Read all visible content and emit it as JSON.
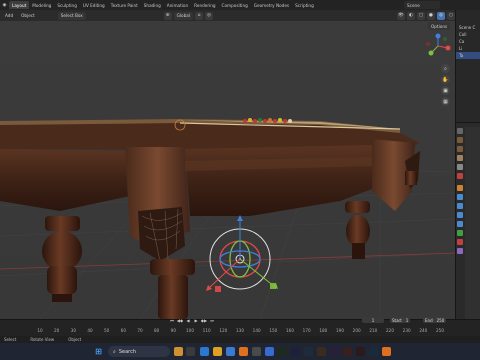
{
  "workspace_tabs": [
    "Layout",
    "Modeling",
    "Sculpting",
    "UV Editing",
    "Texture Paint",
    "Shading",
    "Animation",
    "Rendering",
    "Compositing",
    "Geometry Nodes",
    "Scripting"
  ],
  "active_tab": "Layout",
  "scene": {
    "label": "Scene"
  },
  "viewport_header": {
    "mode": "Add",
    "object_menu": "Object",
    "orientation": "Global",
    "options": "Options",
    "select_box": "Select Box"
  },
  "outliner": {
    "rows": [
      "Scene C",
      "Coll",
      "Ca",
      "Li",
      "Ta"
    ]
  },
  "timeline": {
    "ticks": [
      "10",
      "20",
      "30",
      "40",
      "50",
      "60",
      "70",
      "80",
      "90",
      "100",
      "110",
      "120",
      "130",
      "140",
      "150",
      "160",
      "170",
      "180",
      "190",
      "200",
      "210",
      "220",
      "230",
      "240",
      "250"
    ],
    "current_frame": "1",
    "start_label": "Start",
    "start_value": "1",
    "end_label": "End",
    "end_value": "250"
  },
  "status_bar": {
    "items": [
      "Select",
      "Rotate View",
      "Object"
    ]
  },
  "taskbar": {
    "search_label": "Search"
  },
  "colors": {
    "accent": "#4772b3",
    "gizmo_x": "#e24a4a",
    "gizmo_y": "#7fbf3f",
    "gizmo_z": "#3f7fe0"
  }
}
